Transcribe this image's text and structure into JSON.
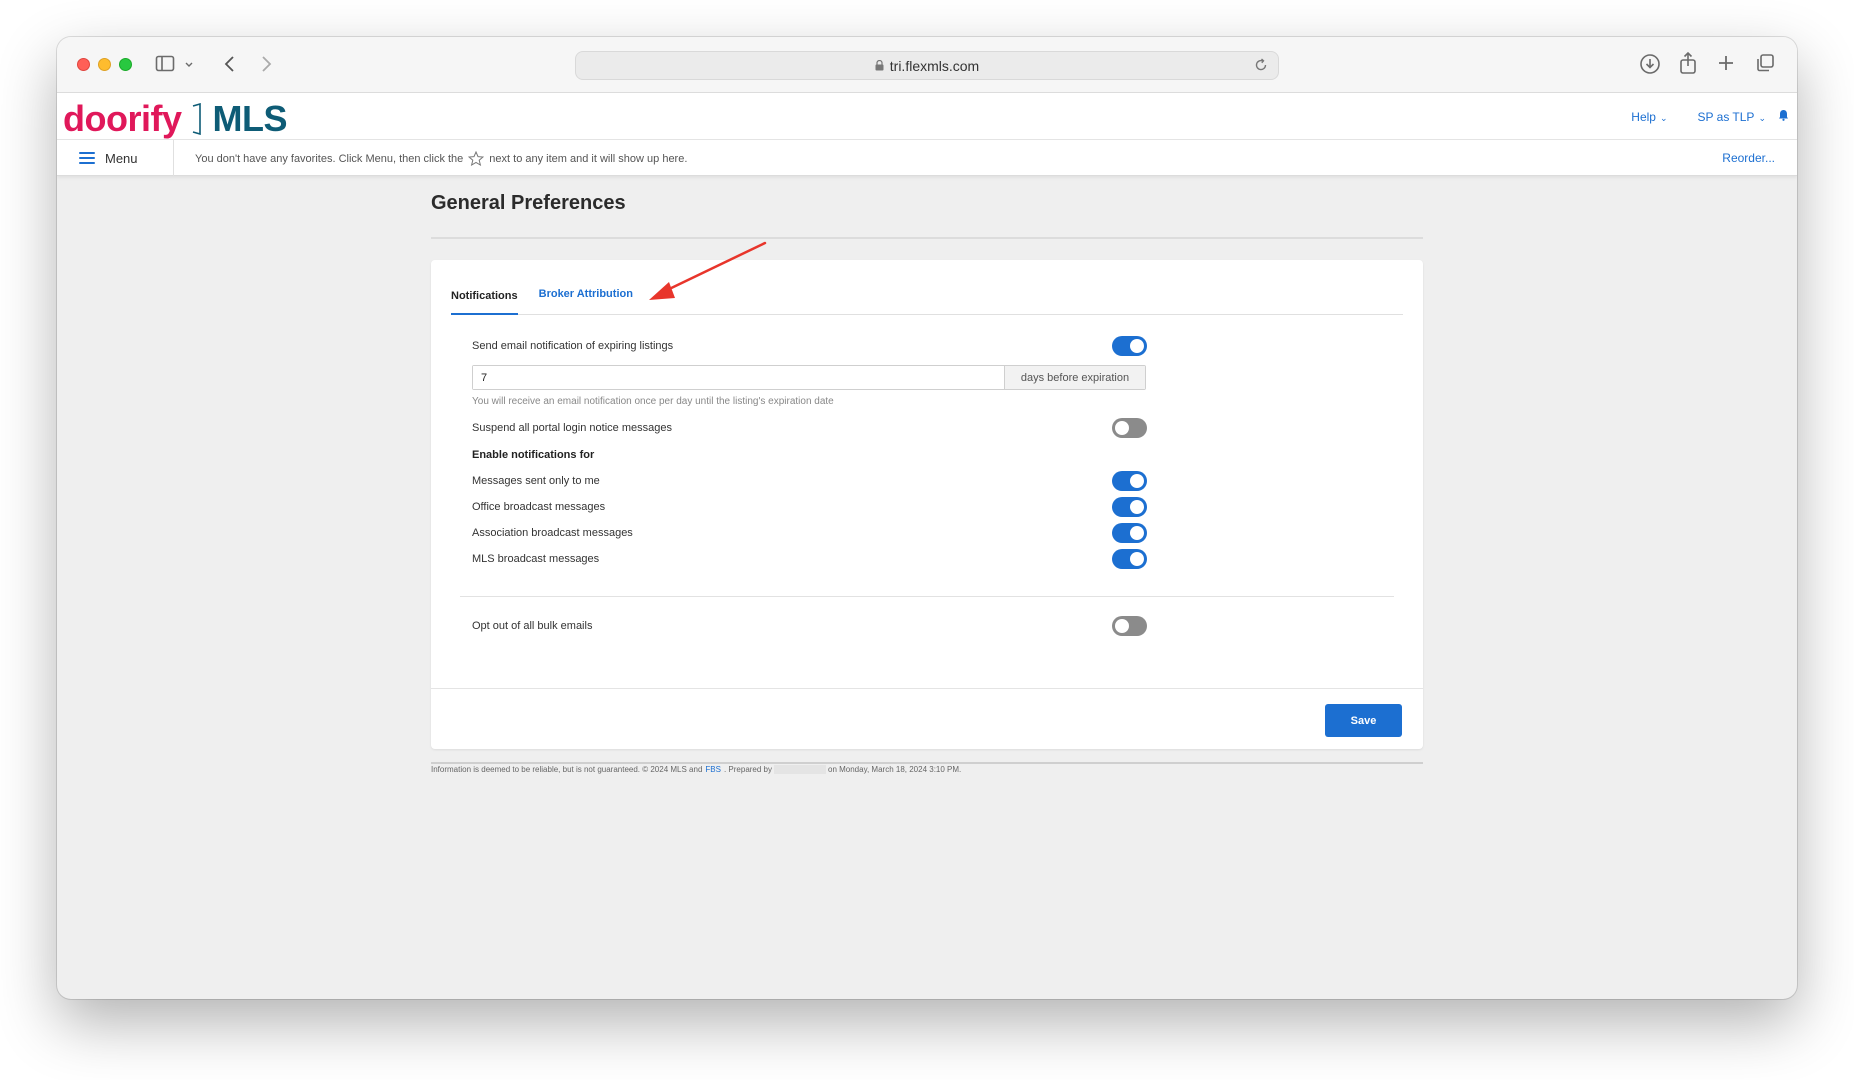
{
  "browser": {
    "url": "tri.flexmls.com"
  },
  "header": {
    "logo_doorify": "doorify",
    "logo_mls": "MLS",
    "help_label": "Help",
    "user_label": "SP as TLP"
  },
  "favorites_bar": {
    "menu_label": "Menu",
    "message_before": "You don't have any favorites. Click Menu, then click the",
    "message_after": "next to any item and it will show up here.",
    "reorder_label": "Reorder..."
  },
  "page": {
    "title": "General Preferences"
  },
  "tabs": [
    {
      "label": "Notifications",
      "active": true
    },
    {
      "label": "Broker Attribution",
      "active": false
    }
  ],
  "settings": {
    "expiring_label": "Send email notification of expiring listings",
    "expiring_enabled": true,
    "days_value": "7",
    "days_suffix": "days before expiration",
    "days_help": "You will receive an email notification once per day until the listing's expiration date",
    "suspend_label": "Suspend all portal login notice messages",
    "suspend_enabled": false,
    "enable_section_label": "Enable notifications for",
    "messages_me_label": "Messages sent only to me",
    "messages_me_enabled": true,
    "office_label": "Office broadcast messages",
    "office_enabled": true,
    "association_label": "Association broadcast messages",
    "association_enabled": true,
    "mls_label": "MLS broadcast messages",
    "mls_enabled": true,
    "optout_label": "Opt out of all bulk emails",
    "optout_enabled": false
  },
  "actions": {
    "save_label": "Save"
  },
  "footer": {
    "text_before": "Information is deemed to be reliable, but is not guaranteed. © 2024 MLS and",
    "fbs_link": "FBS",
    "prepared_by": ". Prepared by",
    "text_after": "on Monday, March 18, 2024 3:10 PM."
  },
  "colors": {
    "accent": "#1c6fd1",
    "brand_pink": "#e0185a",
    "brand_teal": "#0e5c76",
    "annotation_arrow": "#e8352b"
  }
}
